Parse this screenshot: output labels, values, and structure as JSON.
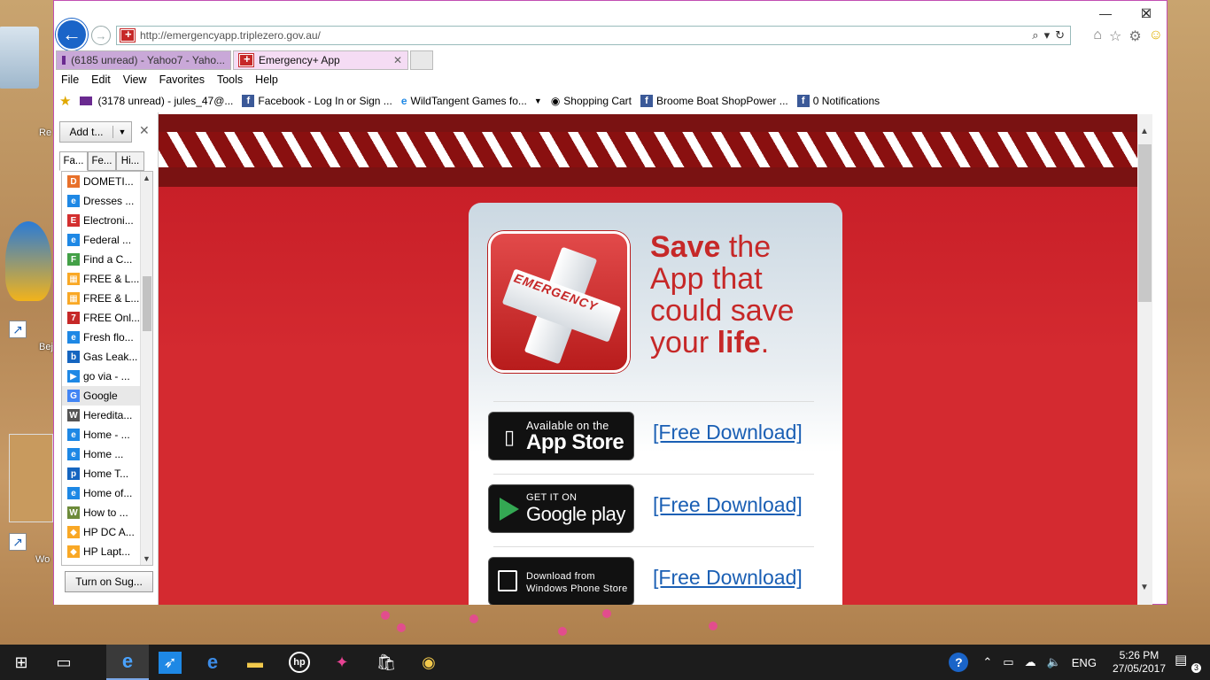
{
  "desktop": {
    "icon_labels": [
      "Re",
      "Bej",
      "Wo"
    ]
  },
  "browser": {
    "address": {
      "url": "http://emergencyapp.triplezero.gov.au/",
      "search_icon": "search-icon",
      "refresh_icon": "refresh-icon"
    },
    "window_controls": {
      "minimize": "—",
      "maximize": "☐",
      "close": "✕"
    },
    "toolbar_icons": [
      "home-icon",
      "star-icon",
      "gear-icon",
      "smiley-icon"
    ],
    "tabs": [
      {
        "label": "(6185 unread) - Yahoo7 - Yaho...",
        "active": false
      },
      {
        "label": "Emergency+ App",
        "active": true
      }
    ],
    "menu": [
      "File",
      "Edit",
      "View",
      "Favorites",
      "Tools",
      "Help"
    ],
    "favorites_bar": [
      {
        "label": "(3178 unread) - jules_47@...",
        "icon": "mail-icon"
      },
      {
        "label": "Facebook - Log In or Sign ...",
        "icon": "facebook-icon"
      },
      {
        "label": "WildTangent Games fo...",
        "icon": "ie-icon",
        "dropdown": true
      },
      {
        "label": "Shopping Cart",
        "icon": "cart-icon"
      },
      {
        "label": "Broome Boat ShopPower ...",
        "icon": "facebook-icon"
      },
      {
        "label": "0 Notifications",
        "icon": "facebook-icon"
      }
    ]
  },
  "favorites_pane": {
    "add_button": "Add t...",
    "tabs": [
      "Fa...",
      "Fe...",
      "Hi..."
    ],
    "items": [
      {
        "label": "DOMETI...",
        "color": "#e8702a",
        "glyph": "D"
      },
      {
        "label": "Dresses  ...",
        "color": "#1e88e5",
        "glyph": "e"
      },
      {
        "label": "Electroni...",
        "color": "#d32f2f",
        "glyph": "E"
      },
      {
        "label": "Federal ...",
        "color": "#1e88e5",
        "glyph": "e"
      },
      {
        "label": "Find a C...",
        "color": "#43a047",
        "glyph": "F"
      },
      {
        "label": "FREE & L...",
        "color": "#f9a825",
        "glyph": "▦"
      },
      {
        "label": "FREE & L...",
        "color": "#f9a825",
        "glyph": "▦"
      },
      {
        "label": "FREE Onl...",
        "color": "#c62828",
        "glyph": "7"
      },
      {
        "label": "Fresh flo...",
        "color": "#1e88e5",
        "glyph": "e"
      },
      {
        "label": "Gas Leak...",
        "color": "#1565c0",
        "glyph": "b"
      },
      {
        "label": "go via - ...",
        "color": "#1e88e5",
        "glyph": "▶"
      },
      {
        "label": "Google",
        "color": "#4285f4",
        "glyph": "G"
      },
      {
        "label": "Heredita...",
        "color": "#555555",
        "glyph": "W"
      },
      {
        "label": "Home - ...",
        "color": "#1e88e5",
        "glyph": "e"
      },
      {
        "label": "Home  ...",
        "color": "#1e88e5",
        "glyph": "e"
      },
      {
        "label": "Home  T...",
        "color": "#1565c0",
        "glyph": "p"
      },
      {
        "label": "Home of...",
        "color": "#1e88e5",
        "glyph": "e"
      },
      {
        "label": "How to ...",
        "color": "#6d8b3a",
        "glyph": "W"
      },
      {
        "label": "HP DC A...",
        "color": "#f9a825",
        "glyph": "◆"
      },
      {
        "label": "HP Lapt...",
        "color": "#f9a825",
        "glyph": "◆"
      }
    ],
    "turn_on_button": "Turn on Sug..."
  },
  "page": {
    "app_icon_text": "EMERGENCY",
    "tagline": {
      "save": "Save",
      "the": " the",
      "line2": "App that",
      "line3": "could save",
      "your": "your ",
      "life": "life",
      "dot": "."
    },
    "badges": [
      {
        "small": "Available on the",
        "big": "App Store",
        "link": "[Free Download]"
      },
      {
        "small": "GET IT ON",
        "big": "Google play",
        "link": "[Free Download]"
      },
      {
        "small": "Download from Windows Phone Store",
        "big": "",
        "link": "[Free Download]"
      }
    ]
  },
  "taskbar": {
    "apps": [
      "windows-start-icon",
      "task-view-icon",
      "internet-explorer-icon",
      "rocket-icon",
      "edge-icon",
      "file-explorer-icon",
      "hp-icon",
      "puzzle-icon",
      "store-icon",
      "camera-icon"
    ],
    "tray": {
      "language": "ENG",
      "time": "5:26 PM",
      "date": "27/05/2017",
      "notification_count": "3"
    }
  },
  "colors": {
    "brand_red": "#d42a30",
    "link_blue": "#1a5fb4",
    "tab_accent": "#c24fb2"
  }
}
